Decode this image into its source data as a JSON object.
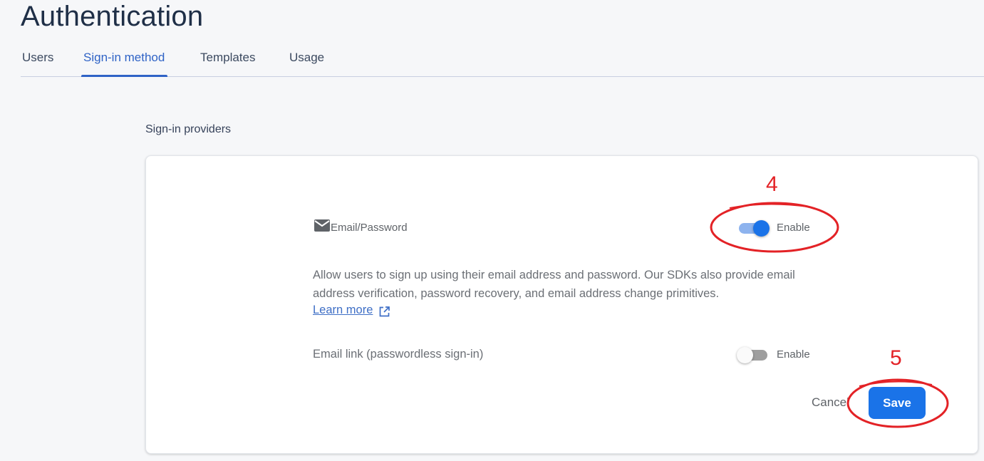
{
  "header": {
    "title": "Authentication"
  },
  "tabs": [
    {
      "label": "Users",
      "active": false
    },
    {
      "label": "Sign-in method",
      "active": true
    },
    {
      "label": "Templates",
      "active": false
    },
    {
      "label": "Usage",
      "active": false
    }
  ],
  "section": {
    "title": "Sign-in providers"
  },
  "provider": {
    "icon": "mail-icon",
    "name": "Email/Password",
    "toggle": {
      "state": "on",
      "label": "Enable"
    },
    "description": "Allow users to sign up using their email address and password. Our SDKs also provide email address verification, password recovery, and email address change primitives.",
    "learn_more": "Learn more",
    "learn_more_icon": "open-in-new-icon"
  },
  "email_link": {
    "label": "Email link (passwordless sign-in)",
    "toggle": {
      "state": "off",
      "label": "Enable"
    }
  },
  "actions": {
    "cancel_label": "Cancel",
    "save_label": "Save"
  },
  "annotations": {
    "step_4": "4",
    "step_5": "5",
    "color": "#e32226"
  },
  "colors": {
    "accent": "#1a73e8",
    "tab_active": "#2f63c6",
    "title": "#1f2f47"
  }
}
